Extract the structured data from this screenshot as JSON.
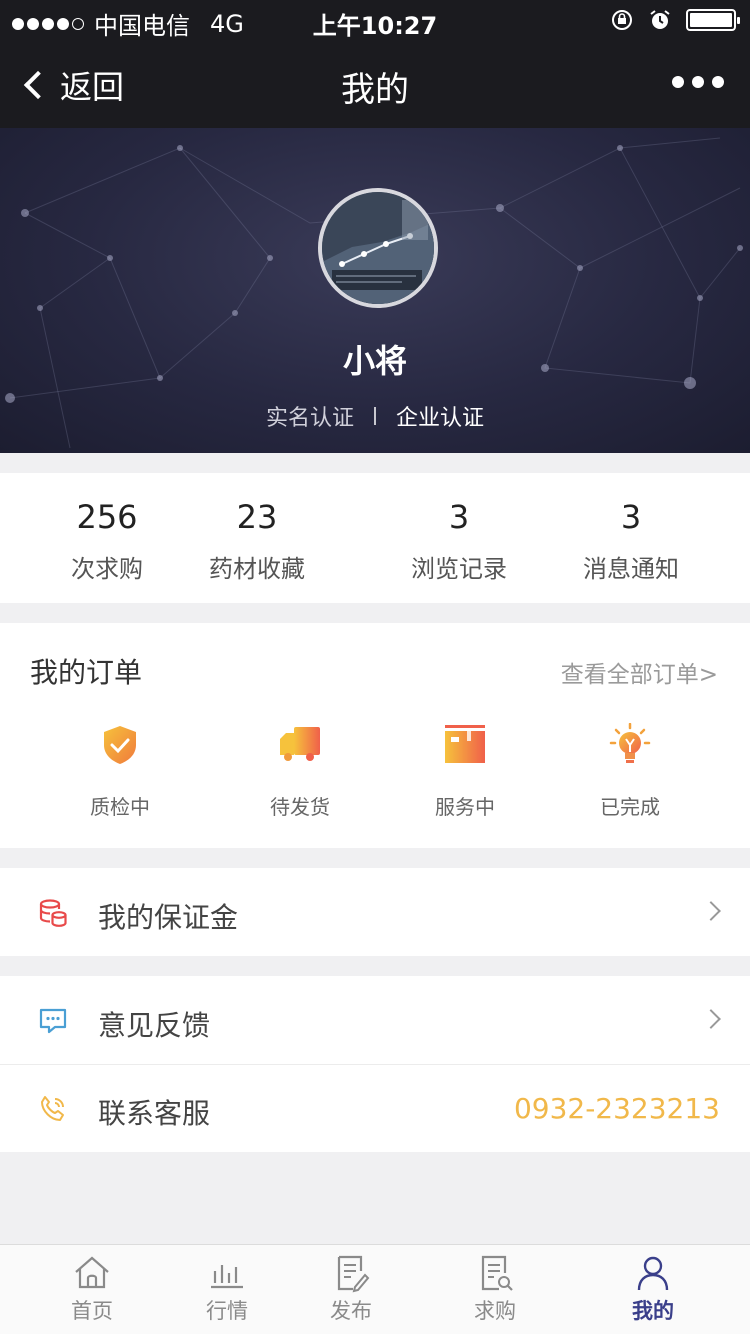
{
  "status_bar": {
    "carrier": "中国电信",
    "network": "4G",
    "time": "上午10:27"
  },
  "nav": {
    "back_label": "返回",
    "title": "我的"
  },
  "profile": {
    "username": "小将",
    "cert_personal": "实名认证",
    "cert_company": "企业认证"
  },
  "stats": [
    {
      "value": "256",
      "label": "次求购"
    },
    {
      "value": "23",
      "label": "药材收藏"
    },
    {
      "value": "3",
      "label": "浏览记录"
    },
    {
      "value": "3",
      "label": "消息通知"
    }
  ],
  "orders": {
    "title": "我的订单",
    "view_all": "查看全部订单>",
    "items": [
      {
        "label": "质检中",
        "icon": "shield-check-icon"
      },
      {
        "label": "待发货",
        "icon": "truck-icon"
      },
      {
        "label": "服务中",
        "icon": "package-icon"
      },
      {
        "label": "已完成",
        "icon": "lightbulb-icon"
      }
    ]
  },
  "menu": {
    "deposit_label": "我的保证金",
    "feedback_label": "意见反馈",
    "service_label": "联系客服",
    "service_phone": "0932-2323213"
  },
  "tabs": [
    {
      "label": "首页",
      "icon": "home-icon"
    },
    {
      "label": "行情",
      "icon": "chart-bars-icon"
    },
    {
      "label": "发布",
      "icon": "edit-doc-icon"
    },
    {
      "label": "求购",
      "icon": "search-doc-icon"
    },
    {
      "label": "我的",
      "icon": "person-icon",
      "active": true
    }
  ],
  "colors": {
    "header_bg": "#1b1b1f",
    "accent_active": "#3a3f8a",
    "phone_color": "#f1b84a",
    "deposit_icon": "#e84a4a",
    "feedback_icon": "#4a9fd4"
  }
}
